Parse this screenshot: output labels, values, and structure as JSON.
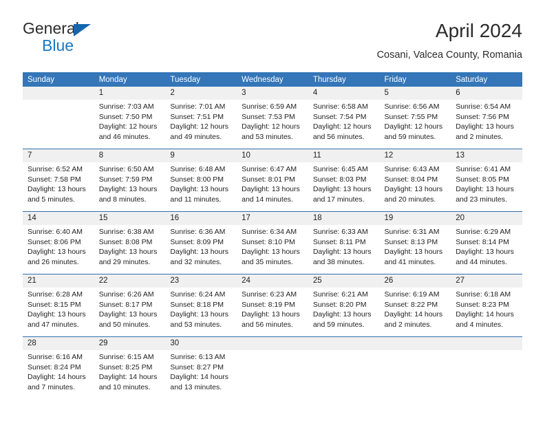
{
  "brand": {
    "name_part1": "General",
    "name_part2": "Blue",
    "logo_icon": "triangle-flag-icon",
    "accent_color": "#1779c4"
  },
  "header": {
    "title": "April 2024",
    "subtitle": "Cosani, Valcea County, Romania"
  },
  "calendar": {
    "header_bg": "#3476b8",
    "row_divider": "#2f6fad",
    "daynum_bg": "#f0f0f0",
    "weekday_headers": [
      "Sunday",
      "Monday",
      "Tuesday",
      "Wednesday",
      "Thursday",
      "Friday",
      "Saturday"
    ],
    "weeks": [
      [
        {
          "day": "",
          "sunrise": "",
          "sunset": "",
          "daylight": "",
          "daylight2": ""
        },
        {
          "day": "1",
          "sunrise": "Sunrise: 7:03 AM",
          "sunset": "Sunset: 7:50 PM",
          "daylight": "Daylight: 12 hours",
          "daylight2": "and 46 minutes."
        },
        {
          "day": "2",
          "sunrise": "Sunrise: 7:01 AM",
          "sunset": "Sunset: 7:51 PM",
          "daylight": "Daylight: 12 hours",
          "daylight2": "and 49 minutes."
        },
        {
          "day": "3",
          "sunrise": "Sunrise: 6:59 AM",
          "sunset": "Sunset: 7:53 PM",
          "daylight": "Daylight: 12 hours",
          "daylight2": "and 53 minutes."
        },
        {
          "day": "4",
          "sunrise": "Sunrise: 6:58 AM",
          "sunset": "Sunset: 7:54 PM",
          "daylight": "Daylight: 12 hours",
          "daylight2": "and 56 minutes."
        },
        {
          "day": "5",
          "sunrise": "Sunrise: 6:56 AM",
          "sunset": "Sunset: 7:55 PM",
          "daylight": "Daylight: 12 hours",
          "daylight2": "and 59 minutes."
        },
        {
          "day": "6",
          "sunrise": "Sunrise: 6:54 AM",
          "sunset": "Sunset: 7:56 PM",
          "daylight": "Daylight: 13 hours",
          "daylight2": "and 2 minutes."
        }
      ],
      [
        {
          "day": "7",
          "sunrise": "Sunrise: 6:52 AM",
          "sunset": "Sunset: 7:58 PM",
          "daylight": "Daylight: 13 hours",
          "daylight2": "and 5 minutes."
        },
        {
          "day": "8",
          "sunrise": "Sunrise: 6:50 AM",
          "sunset": "Sunset: 7:59 PM",
          "daylight": "Daylight: 13 hours",
          "daylight2": "and 8 minutes."
        },
        {
          "day": "9",
          "sunrise": "Sunrise: 6:48 AM",
          "sunset": "Sunset: 8:00 PM",
          "daylight": "Daylight: 13 hours",
          "daylight2": "and 11 minutes."
        },
        {
          "day": "10",
          "sunrise": "Sunrise: 6:47 AM",
          "sunset": "Sunset: 8:01 PM",
          "daylight": "Daylight: 13 hours",
          "daylight2": "and 14 minutes."
        },
        {
          "day": "11",
          "sunrise": "Sunrise: 6:45 AM",
          "sunset": "Sunset: 8:03 PM",
          "daylight": "Daylight: 13 hours",
          "daylight2": "and 17 minutes."
        },
        {
          "day": "12",
          "sunrise": "Sunrise: 6:43 AM",
          "sunset": "Sunset: 8:04 PM",
          "daylight": "Daylight: 13 hours",
          "daylight2": "and 20 minutes."
        },
        {
          "day": "13",
          "sunrise": "Sunrise: 6:41 AM",
          "sunset": "Sunset: 8:05 PM",
          "daylight": "Daylight: 13 hours",
          "daylight2": "and 23 minutes."
        }
      ],
      [
        {
          "day": "14",
          "sunrise": "Sunrise: 6:40 AM",
          "sunset": "Sunset: 8:06 PM",
          "daylight": "Daylight: 13 hours",
          "daylight2": "and 26 minutes."
        },
        {
          "day": "15",
          "sunrise": "Sunrise: 6:38 AM",
          "sunset": "Sunset: 8:08 PM",
          "daylight": "Daylight: 13 hours",
          "daylight2": "and 29 minutes."
        },
        {
          "day": "16",
          "sunrise": "Sunrise: 6:36 AM",
          "sunset": "Sunset: 8:09 PM",
          "daylight": "Daylight: 13 hours",
          "daylight2": "and 32 minutes."
        },
        {
          "day": "17",
          "sunrise": "Sunrise: 6:34 AM",
          "sunset": "Sunset: 8:10 PM",
          "daylight": "Daylight: 13 hours",
          "daylight2": "and 35 minutes."
        },
        {
          "day": "18",
          "sunrise": "Sunrise: 6:33 AM",
          "sunset": "Sunset: 8:11 PM",
          "daylight": "Daylight: 13 hours",
          "daylight2": "and 38 minutes."
        },
        {
          "day": "19",
          "sunrise": "Sunrise: 6:31 AM",
          "sunset": "Sunset: 8:13 PM",
          "daylight": "Daylight: 13 hours",
          "daylight2": "and 41 minutes."
        },
        {
          "day": "20",
          "sunrise": "Sunrise: 6:29 AM",
          "sunset": "Sunset: 8:14 PM",
          "daylight": "Daylight: 13 hours",
          "daylight2": "and 44 minutes."
        }
      ],
      [
        {
          "day": "21",
          "sunrise": "Sunrise: 6:28 AM",
          "sunset": "Sunset: 8:15 PM",
          "daylight": "Daylight: 13 hours",
          "daylight2": "and 47 minutes."
        },
        {
          "day": "22",
          "sunrise": "Sunrise: 6:26 AM",
          "sunset": "Sunset: 8:17 PM",
          "daylight": "Daylight: 13 hours",
          "daylight2": "and 50 minutes."
        },
        {
          "day": "23",
          "sunrise": "Sunrise: 6:24 AM",
          "sunset": "Sunset: 8:18 PM",
          "daylight": "Daylight: 13 hours",
          "daylight2": "and 53 minutes."
        },
        {
          "day": "24",
          "sunrise": "Sunrise: 6:23 AM",
          "sunset": "Sunset: 8:19 PM",
          "daylight": "Daylight: 13 hours",
          "daylight2": "and 56 minutes."
        },
        {
          "day": "25",
          "sunrise": "Sunrise: 6:21 AM",
          "sunset": "Sunset: 8:20 PM",
          "daylight": "Daylight: 13 hours",
          "daylight2": "and 59 minutes."
        },
        {
          "day": "26",
          "sunrise": "Sunrise: 6:19 AM",
          "sunset": "Sunset: 8:22 PM",
          "daylight": "Daylight: 14 hours",
          "daylight2": "and 2 minutes."
        },
        {
          "day": "27",
          "sunrise": "Sunrise: 6:18 AM",
          "sunset": "Sunset: 8:23 PM",
          "daylight": "Daylight: 14 hours",
          "daylight2": "and 4 minutes."
        }
      ],
      [
        {
          "day": "28",
          "sunrise": "Sunrise: 6:16 AM",
          "sunset": "Sunset: 8:24 PM",
          "daylight": "Daylight: 14 hours",
          "daylight2": "and 7 minutes."
        },
        {
          "day": "29",
          "sunrise": "Sunrise: 6:15 AM",
          "sunset": "Sunset: 8:25 PM",
          "daylight": "Daylight: 14 hours",
          "daylight2": "and 10 minutes."
        },
        {
          "day": "30",
          "sunrise": "Sunrise: 6:13 AM",
          "sunset": "Sunset: 8:27 PM",
          "daylight": "Daylight: 14 hours",
          "daylight2": "and 13 minutes."
        },
        {
          "day": "",
          "sunrise": "",
          "sunset": "",
          "daylight": "",
          "daylight2": ""
        },
        {
          "day": "",
          "sunrise": "",
          "sunset": "",
          "daylight": "",
          "daylight2": ""
        },
        {
          "day": "",
          "sunrise": "",
          "sunset": "",
          "daylight": "",
          "daylight2": ""
        },
        {
          "day": "",
          "sunrise": "",
          "sunset": "",
          "daylight": "",
          "daylight2": ""
        }
      ]
    ]
  }
}
